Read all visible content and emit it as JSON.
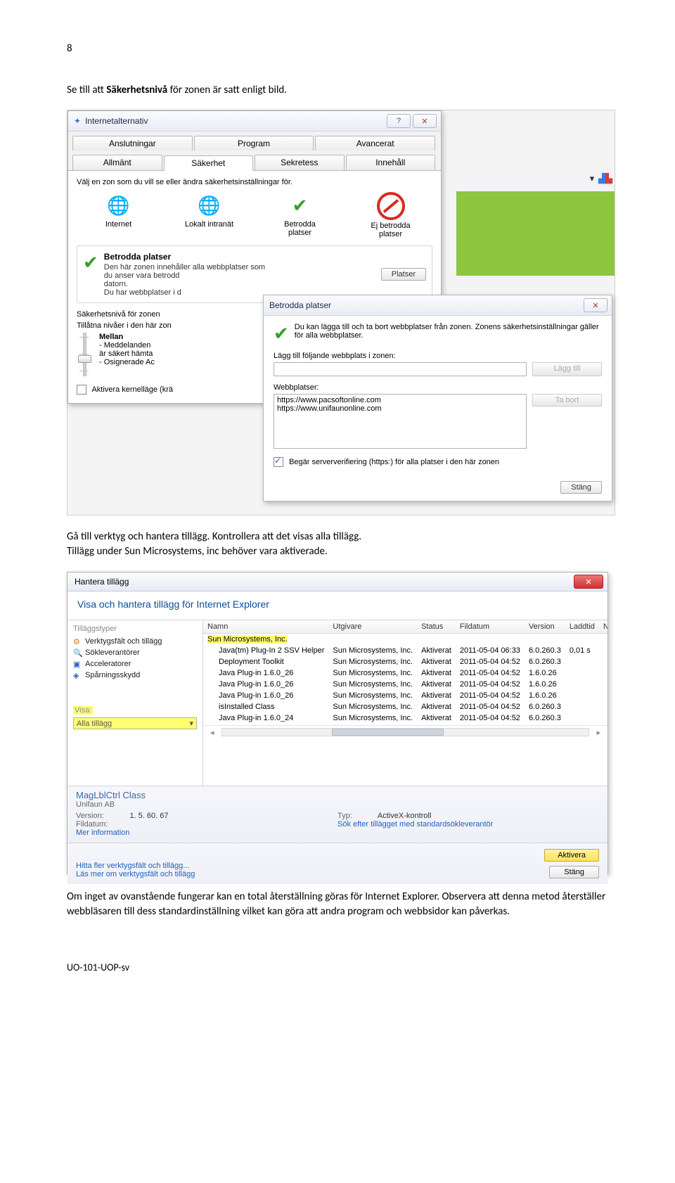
{
  "page_number": "8",
  "intro_pre": "Se till att ",
  "intro_bold": "Säkerhetsnivå",
  "intro_post": " för zonen är satt enligt bild.",
  "dlg1": {
    "title": "Internetalternativ",
    "tabs_top": [
      "Anslutningar",
      "Program",
      "Avancerat"
    ],
    "tabs_bottom": [
      "Allmänt",
      "Säkerhet",
      "Sekretess",
      "Innehåll"
    ],
    "tabs_bottom_active": 1,
    "zone_instruction": "Välj en zon som du vill se eller ändra säkerhetsinställningar för.",
    "zones": [
      {
        "label": "Internet"
      },
      {
        "label": "Lokalt intranät"
      },
      {
        "label1": "Betrodda",
        "label2": "platser"
      },
      {
        "label1": "Ej betrodda",
        "label2": "platser"
      }
    ],
    "zone_box_title": "Betrodda platser",
    "zone_box_l1": "Den här zonen innehåller alla webbplatser som",
    "zone_box_l2": "du anser vara betrodd",
    "zone_box_l3": "datorn.",
    "zone_box_l4": "Du har webbplatser i d",
    "platser_btn": "Platser",
    "sec_level_header": "Säkerhetsnivå för zonen",
    "sec_level_sub": "Tillåtna nivåer i den här zon",
    "level_name": "Mellan",
    "level_l1": "- Meddelanden",
    "level_l2": "  är säkert hämta",
    "level_l3": "- Osignerade Ac",
    "kernel_chk": "Aktivera kernelläge (krä"
  },
  "dlg2": {
    "title": "Betrodda platser",
    "desc": "Du kan lägga till och ta bort webbplatser från zonen. Zonens säkerhetsinställningar gäller för alla webbplatser.",
    "add_label": "Lägg till följande webbplats i zonen:",
    "add_input": "",
    "add_btn": "Lägg till",
    "list_label": "Webbplatser:",
    "sites": [
      "https://www.pacsoftonline.com",
      "https://www.unifaunonline.com"
    ],
    "remove_btn": "Ta bort",
    "verify_chk": "Begär serververifiering (https:) för alla platser i den här zonen",
    "close_btn": "Stäng"
  },
  "mid_text": "Gå till verktyg och hantera tillägg. Kontrollera att det visas alla tillägg.\nTillägg under Sun Microsystems, inc behöver vara aktiverade.",
  "addons": {
    "title": "Hantera tillägg",
    "header_blue": "Visa och hantera tillägg för Internet Explorer",
    "left_label": "Tilläggstyper",
    "left_items": [
      "Verktygsfält och tillägg",
      "Sökleverantörer",
      "Acceleratorer",
      "Spårningsskydd"
    ],
    "visa_label": "Visa:",
    "visa_value": "Alla tillägg",
    "columns": [
      "Namn",
      "Utgivare",
      "Status",
      "Fildatum",
      "Version",
      "Laddtid",
      "Navigeri"
    ],
    "publisher_row": "Sun Microsystems, Inc.",
    "rows": [
      {
        "n": "Java(tm) Plug-In 2 SSV Helper",
        "u": "Sun Microsystems, Inc.",
        "s": "Aktiverat",
        "d": "2011-05-04 06:33",
        "v": "6.0.260.3",
        "l": "0,01 s"
      },
      {
        "n": "Deployment Toolkit",
        "u": "Sun Microsystems, Inc.",
        "s": "Aktiverat",
        "d": "2011-05-04 04:52",
        "v": "6.0.260.3",
        "l": ""
      },
      {
        "n": "Java Plug-in 1.6.0_26",
        "u": "Sun Microsystems, Inc.",
        "s": "Aktiverat",
        "d": "2011-05-04 04:52",
        "v": "1.6.0.26",
        "l": ""
      },
      {
        "n": "Java Plug-in 1.6.0_26",
        "u": "Sun Microsystems, Inc.",
        "s": "Aktiverat",
        "d": "2011-05-04 04:52",
        "v": "1.6.0.26",
        "l": ""
      },
      {
        "n": "Java Plug-in 1.6.0_26",
        "u": "Sun Microsystems, Inc.",
        "s": "Aktiverat",
        "d": "2011-05-04 04:52",
        "v": "1.6.0.26",
        "l": ""
      },
      {
        "n": "isInstalled Class",
        "u": "Sun Microsystems, Inc.",
        "s": "Aktiverat",
        "d": "2011-05-04 04:52",
        "v": "6.0.260.3",
        "l": ""
      },
      {
        "n": "Java Plug-in 1.6.0_24",
        "u": "Sun Microsystems, Inc.",
        "s": "Aktiverat",
        "d": "2011-05-04 04:52",
        "v": "6.0.260.3",
        "l": ""
      }
    ],
    "detail_name": "MagLblCtrl Class",
    "detail_pub": "Unifaun AB",
    "k_version": "Version:",
    "v_version": "1. 5. 60. 67",
    "k_fildatum": "Fildatum:",
    "k_merinfo": "Mer information",
    "k_typ": "Typ:",
    "v_typ": "ActiveX-kontroll",
    "link_search": "Sök efter tillägget med standardsökleverantör",
    "link_find": "Hitta fler verktygsfält och tillägg...",
    "link_learn": "Läs mer om verktygsfält och tillägg",
    "btn_enable": "Aktivera",
    "btn_close": "Stäng"
  },
  "outro": "Om inget av ovanstående fungerar kan en total återställning göras för Internet Explorer. Observera att denna metod återställer webbläsaren till dess standardinställning vilket kan göra att andra program och webbsidor kan påverkas.",
  "docid": "UO-101-UOP-sv"
}
